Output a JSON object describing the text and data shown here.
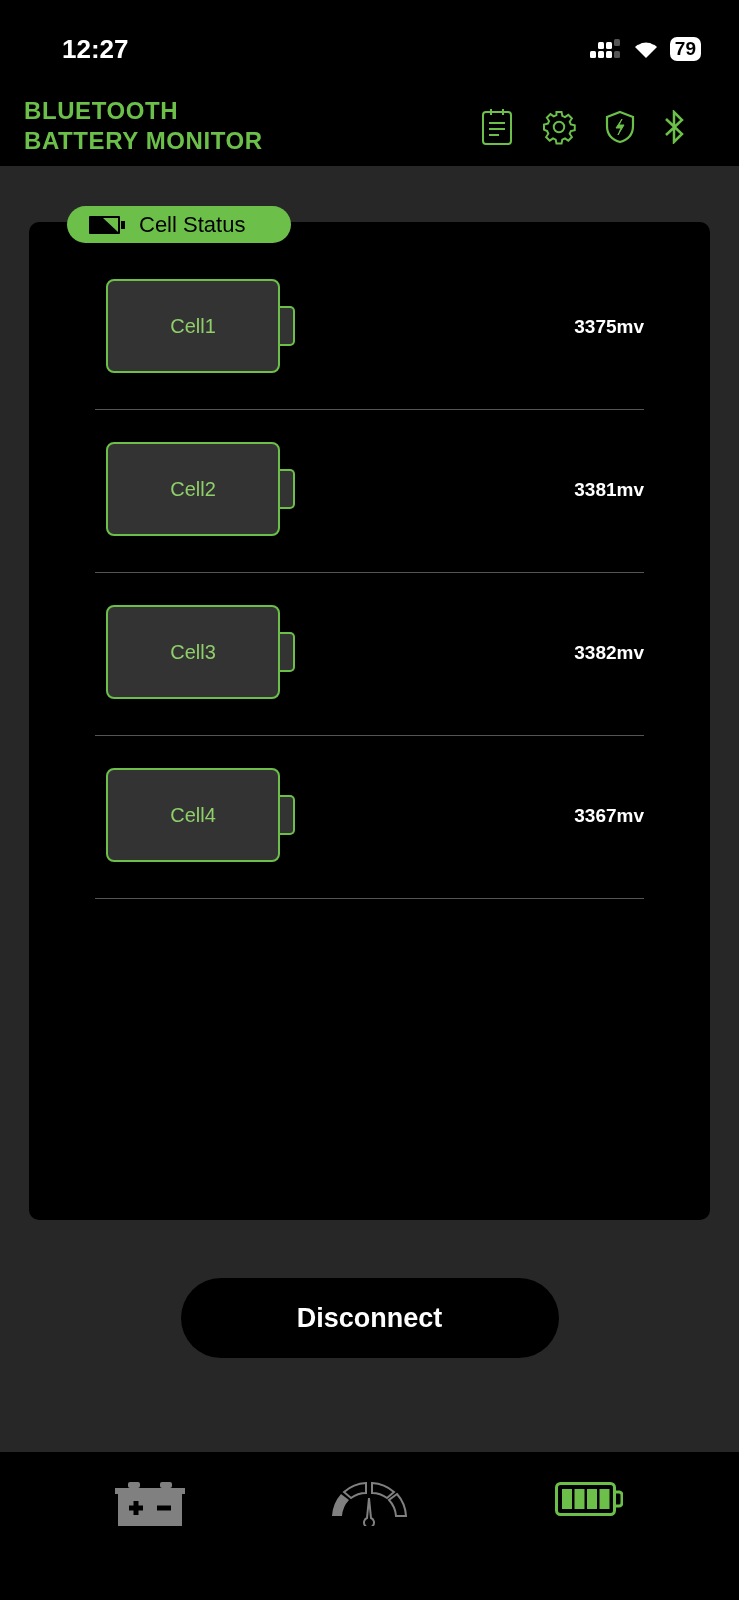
{
  "status_bar": {
    "time": "12:27",
    "battery": "79"
  },
  "header": {
    "title_lines": [
      "BLUETOOTH",
      "BATTERY MONITOR"
    ]
  },
  "section": {
    "title": "Cell Status"
  },
  "cells": [
    {
      "name": "Cell1",
      "reading": "3375mv"
    },
    {
      "name": "Cell2",
      "reading": "3381mv"
    },
    {
      "name": "Cell3",
      "reading": "3382mv"
    },
    {
      "name": "Cell4",
      "reading": "3367mv"
    }
  ],
  "disconnect_button": "Disconnect",
  "bottom_nav": [
    {
      "kind": "car-battery",
      "selected": false
    },
    {
      "kind": "gauge",
      "selected": false
    },
    {
      "kind": "cells",
      "selected": true
    }
  ]
}
